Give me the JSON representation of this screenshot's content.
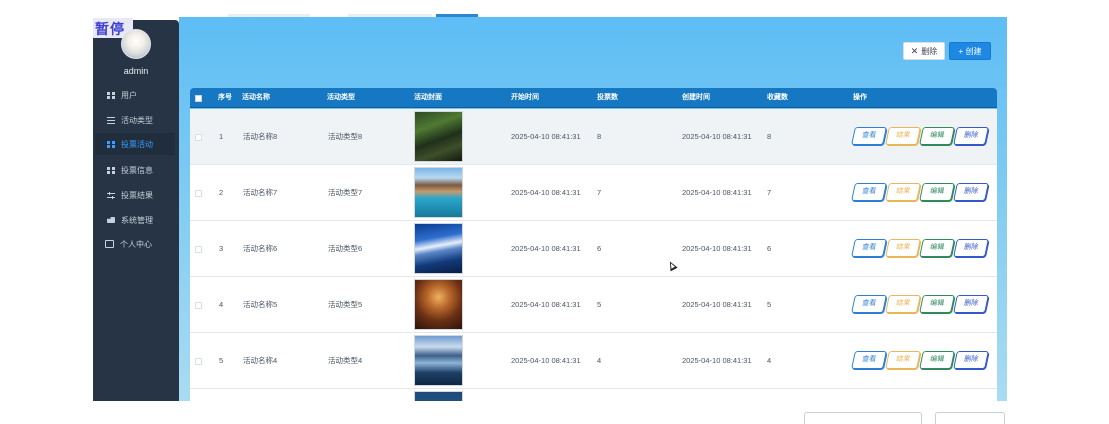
{
  "overlay": {
    "pause_label": "暂停"
  },
  "sidebar": {
    "user_name": "admin",
    "items": [
      {
        "label": "用户",
        "icon": "grid-icon"
      },
      {
        "label": "活动类型",
        "icon": "list-icon"
      },
      {
        "label": "投票活动",
        "icon": "grid-icon",
        "active": true
      },
      {
        "label": "投票信息",
        "icon": "grid-icon"
      },
      {
        "label": "投票结果",
        "icon": "slider-icon"
      },
      {
        "label": "系统管理",
        "icon": "gear-icon"
      },
      {
        "label": "个人中心",
        "icon": "person-icon"
      }
    ]
  },
  "toolbar": {
    "delete_label": "删除",
    "create_label": "+ 创建"
  },
  "table": {
    "columns": [
      "序号",
      "活动名称",
      "活动类型",
      "活动封面",
      "开始时间",
      "投票数",
      "创建时间",
      "收藏数",
      "操作"
    ],
    "rows": [
      {
        "index": "1",
        "name": "活动名称8",
        "type": "活动类型8",
        "start": "2025-04-10 08:41:31",
        "votes": "8",
        "created": "2025-04-10 08:41:31",
        "favs": "8",
        "cover": "forest-road"
      },
      {
        "index": "2",
        "name": "活动名称7",
        "type": "活动类型7",
        "start": "2025-04-10 08:41:31",
        "votes": "7",
        "created": "2025-04-10 08:41:31",
        "favs": "7",
        "cover": "resort-pool"
      },
      {
        "index": "3",
        "name": "活动名称6",
        "type": "活动类型6",
        "start": "2025-04-10 08:41:31",
        "votes": "6",
        "created": "2025-04-10 08:41:31",
        "favs": "6",
        "cover": "snow-mountain"
      },
      {
        "index": "4",
        "name": "活动名称5",
        "type": "活动类型5",
        "start": "2025-04-10 08:41:31",
        "votes": "5",
        "created": "2025-04-10 08:41:31",
        "favs": "5",
        "cover": "restaurant-interior"
      },
      {
        "index": "5",
        "name": "活动名称4",
        "type": "活动类型4",
        "start": "2025-04-10 08:41:31",
        "votes": "4",
        "created": "2025-04-10 08:41:31",
        "favs": "4",
        "cover": "lake-mountain"
      }
    ],
    "actions": {
      "view": "查看",
      "stats": "结果",
      "edit": "编辑",
      "delete": "删除"
    }
  },
  "colors": {
    "sidebar_bg": "#263445",
    "header_bg": "#1678c2",
    "primary": "#1e88e5",
    "main_bg": "#5dbdf5"
  }
}
